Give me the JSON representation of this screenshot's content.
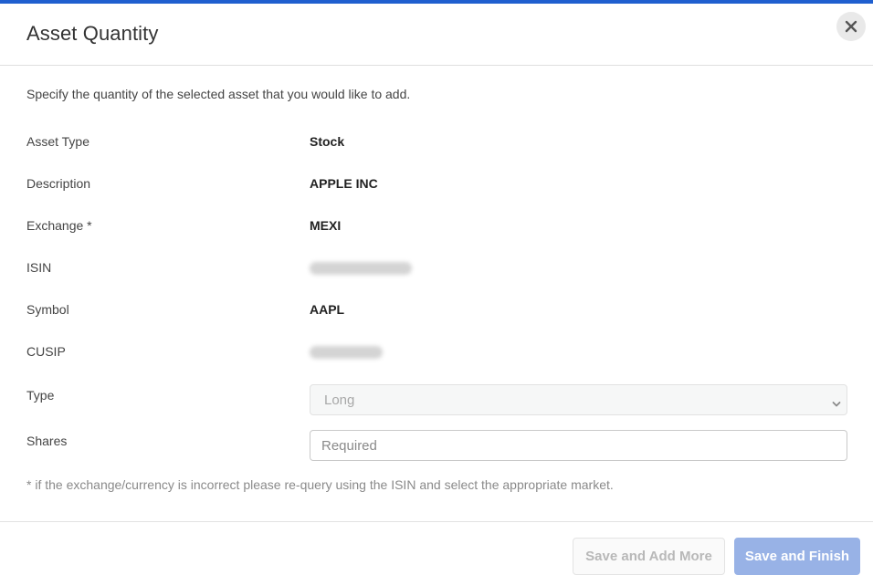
{
  "dialog": {
    "title": "Asset Quantity",
    "close_icon": "close-icon",
    "instruction": "Specify the quantity of the selected asset that you would like to add."
  },
  "fields": {
    "asset_type": {
      "label": "Asset Type",
      "value": "Stock"
    },
    "description": {
      "label": "Description",
      "value": "APPLE INC"
    },
    "exchange": {
      "label": "Exchange *",
      "value": "MEXI"
    },
    "isin": {
      "label": "ISIN"
    },
    "symbol": {
      "label": "Symbol",
      "value": "AAPL"
    },
    "cusip": {
      "label": "CUSIP"
    },
    "type": {
      "label": "Type",
      "selected": "Long"
    },
    "shares": {
      "label": "Shares",
      "placeholder": "Required"
    }
  },
  "footnote": "* if the exchange/currency is incorrect please re-query using the ISIN and select the appropriate market.",
  "footer": {
    "save_add_more_label": "Save and Add More",
    "save_finish_label": "Save and Finish"
  },
  "colors": {
    "accent": "#1f5fcf",
    "primary_button_disabled": "#98b2e6"
  }
}
